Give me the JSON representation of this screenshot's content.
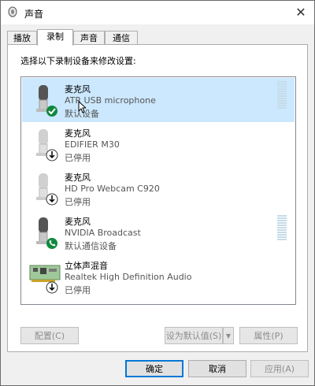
{
  "window": {
    "title": "声音",
    "close_symbol": "✕"
  },
  "tabs": [
    {
      "label": "播放",
      "active": false
    },
    {
      "label": "录制",
      "active": true
    },
    {
      "label": "声音",
      "active": false
    },
    {
      "label": "通信",
      "active": false
    }
  ],
  "instruction": "选择以下录制设备来修改设置:",
  "devices": [
    {
      "name": "麦克风",
      "description": "ATR USB microphone",
      "status": "默认设备",
      "icon": "microphone-icon",
      "badge": "green-check",
      "selected": true,
      "has_meter": true
    },
    {
      "name": "麦克风",
      "description": "EDIFIER M30",
      "status": "已停用",
      "icon": "microphone-icon",
      "badge": "down-arrow",
      "selected": false,
      "has_meter": false
    },
    {
      "name": "麦克风",
      "description": "HD Pro Webcam C920",
      "status": "已停用",
      "icon": "microphone-icon",
      "badge": "down-arrow",
      "selected": false,
      "has_meter": false
    },
    {
      "name": "麦克风",
      "description": "NVIDIA Broadcast",
      "status": "默认通信设备",
      "icon": "microphone-icon",
      "badge": "green-phone",
      "selected": false,
      "has_meter": true
    },
    {
      "name": "立体声混音",
      "description": "Realtek High Definition Audio",
      "status": "已停用",
      "icon": "sound-card-icon",
      "badge": "down-arrow",
      "selected": false,
      "has_meter": false
    }
  ],
  "buttons": {
    "configure": "配置(C)",
    "set_default": "设为默认值(S)",
    "properties": "属性(P)",
    "ok": "确定",
    "cancel": "取消",
    "apply": "应用(A)"
  },
  "colors": {
    "selected_row": "#cce8ff",
    "accent": "#0078d7",
    "check_green": "#10893e"
  }
}
